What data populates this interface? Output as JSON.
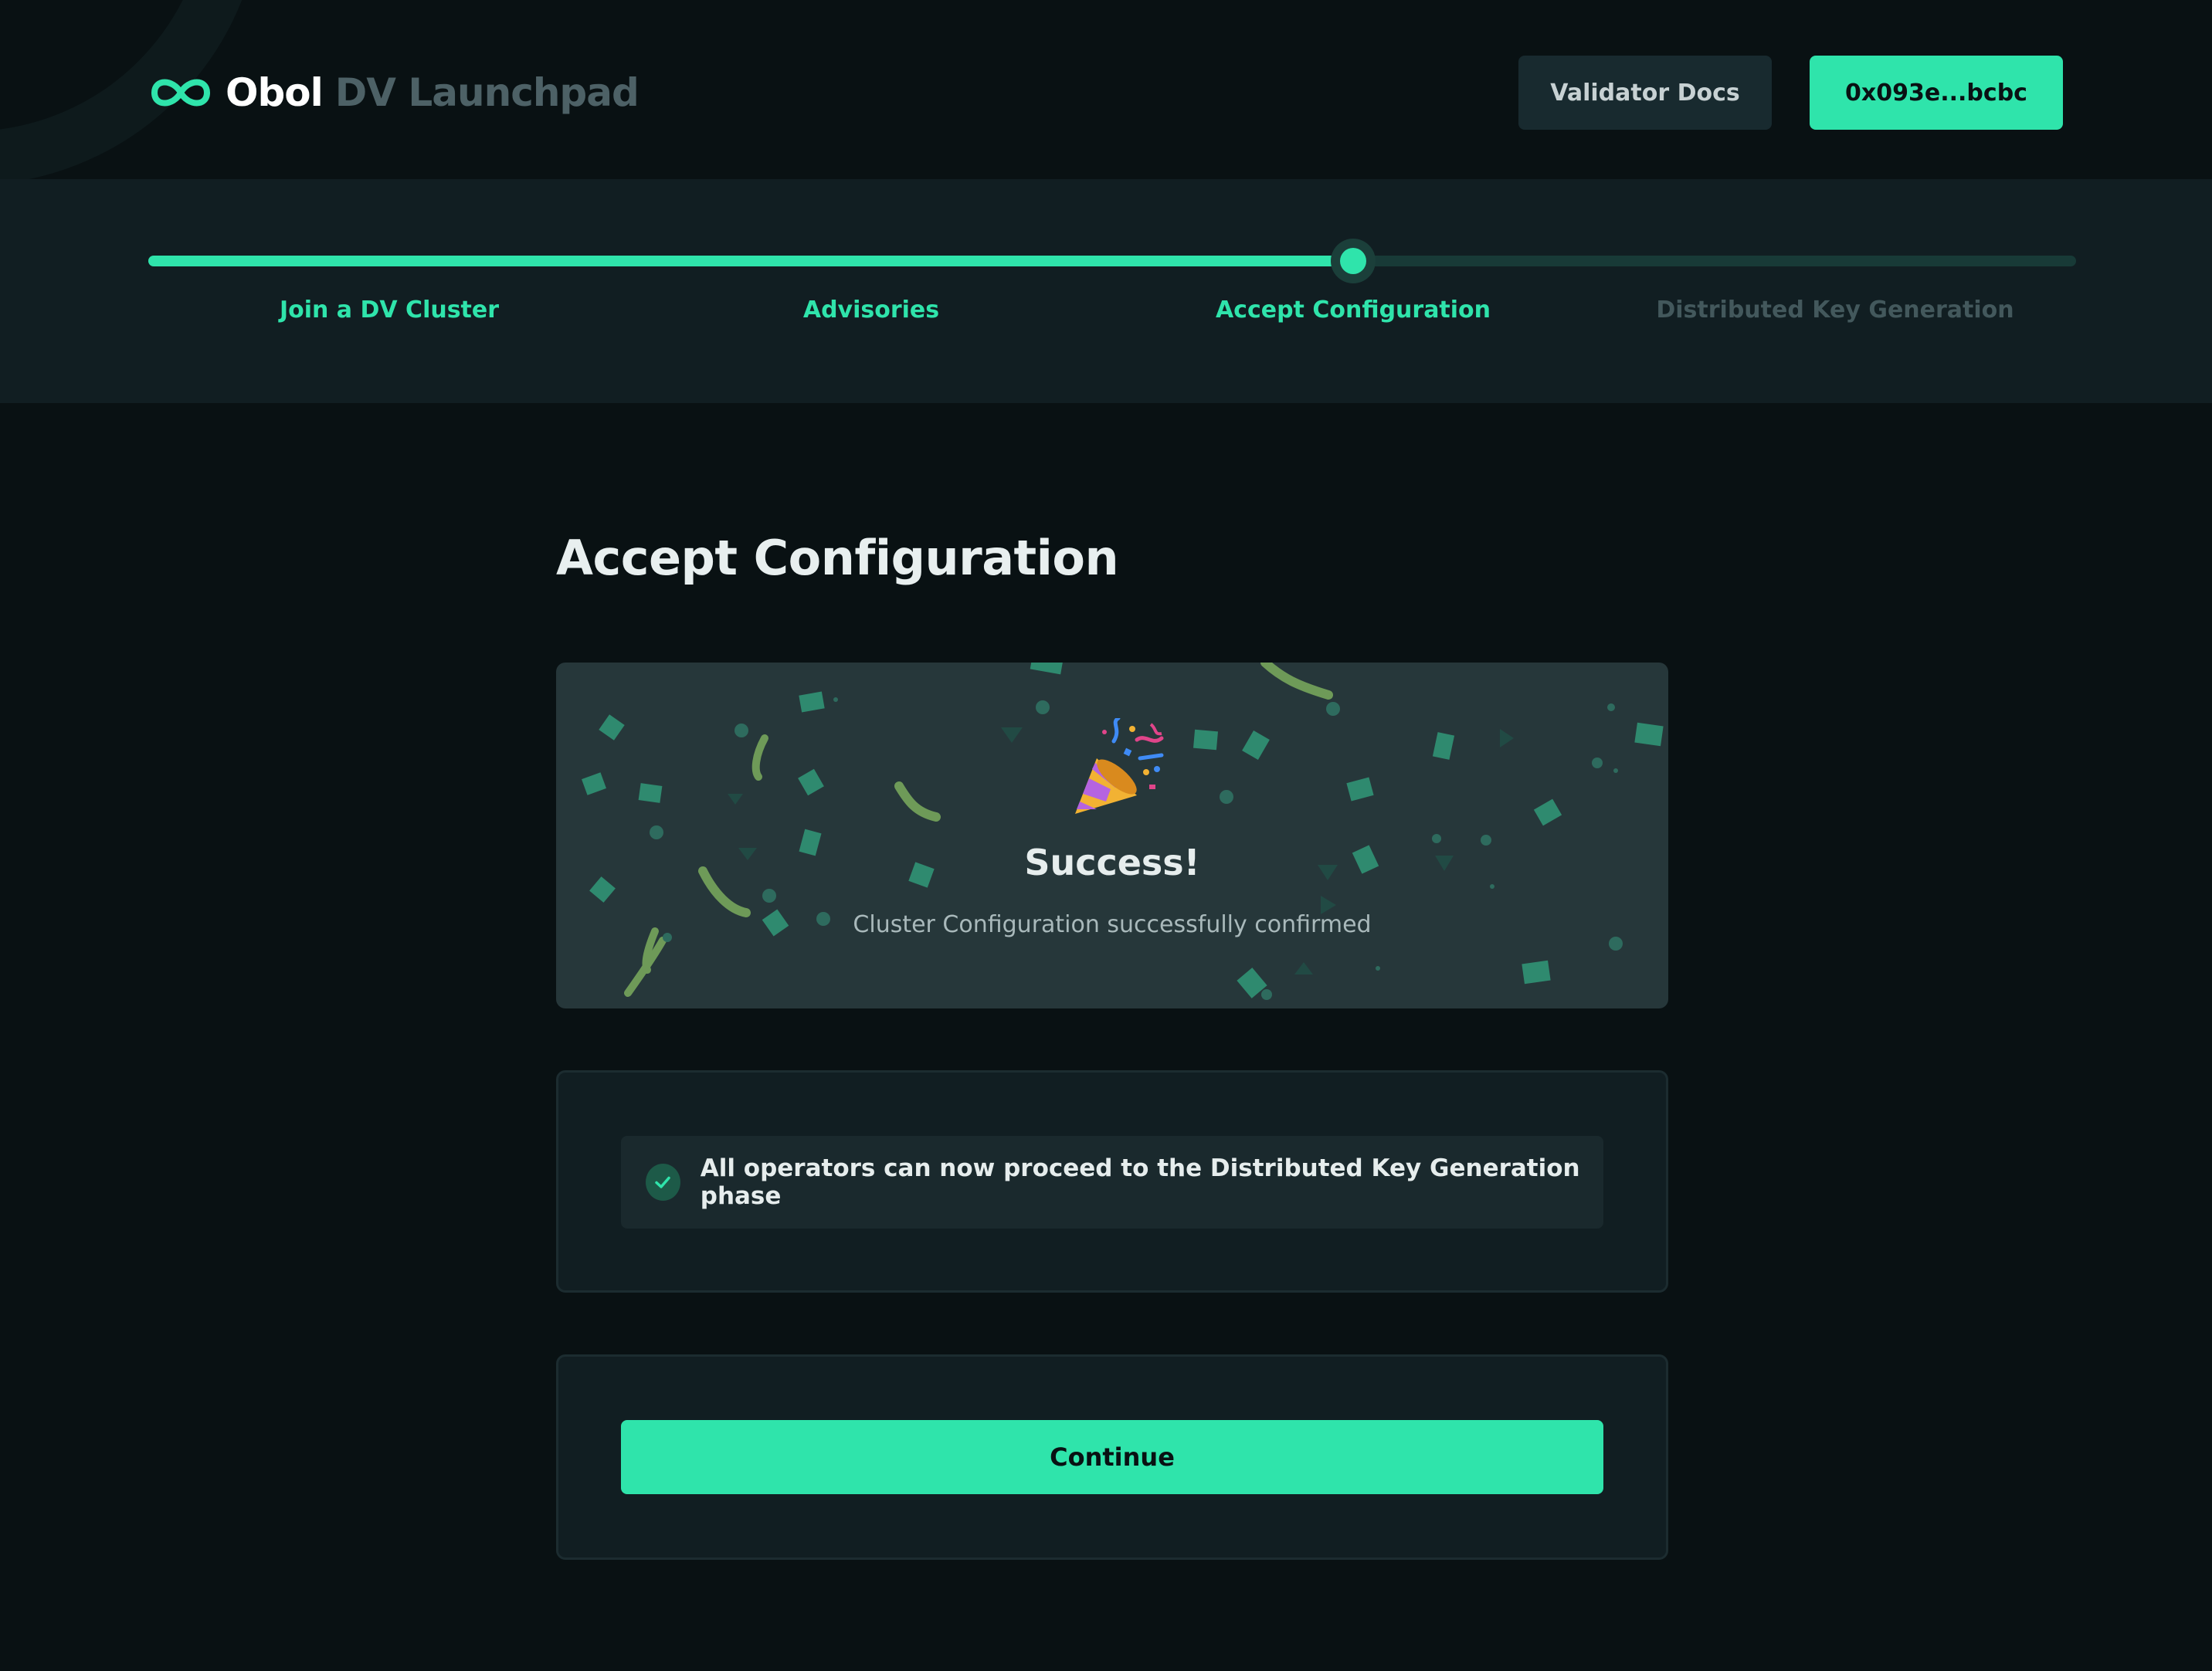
{
  "header": {
    "logo_primary": "Obol",
    "logo_secondary": "DV Launchpad",
    "docs_button": "Validator Docs",
    "wallet_button": "0x093e...bcbc"
  },
  "stepper": {
    "current_step": 3,
    "total_steps": 4,
    "progress_fraction": 0.625,
    "steps": [
      {
        "label": "Join a DV Cluster",
        "status": "complete"
      },
      {
        "label": "Advisories",
        "status": "complete"
      },
      {
        "label": "Accept Configuration",
        "status": "current"
      },
      {
        "label": "Distributed Key Generation",
        "status": "upcoming"
      }
    ]
  },
  "page": {
    "title": "Accept Configuration"
  },
  "success": {
    "icon": "party-popper-icon",
    "title": "Success!",
    "message": "Cluster Configuration successfully confirmed"
  },
  "info": {
    "icon": "check-circle-icon",
    "message": "All operators can now proceed to the Distributed Key Generation phase"
  },
  "actions": {
    "continue_label": "Continue"
  },
  "colors": {
    "accent": "#2fe4ab",
    "background": "#091113",
    "panel": "#111e22",
    "muted": "#43585c"
  }
}
